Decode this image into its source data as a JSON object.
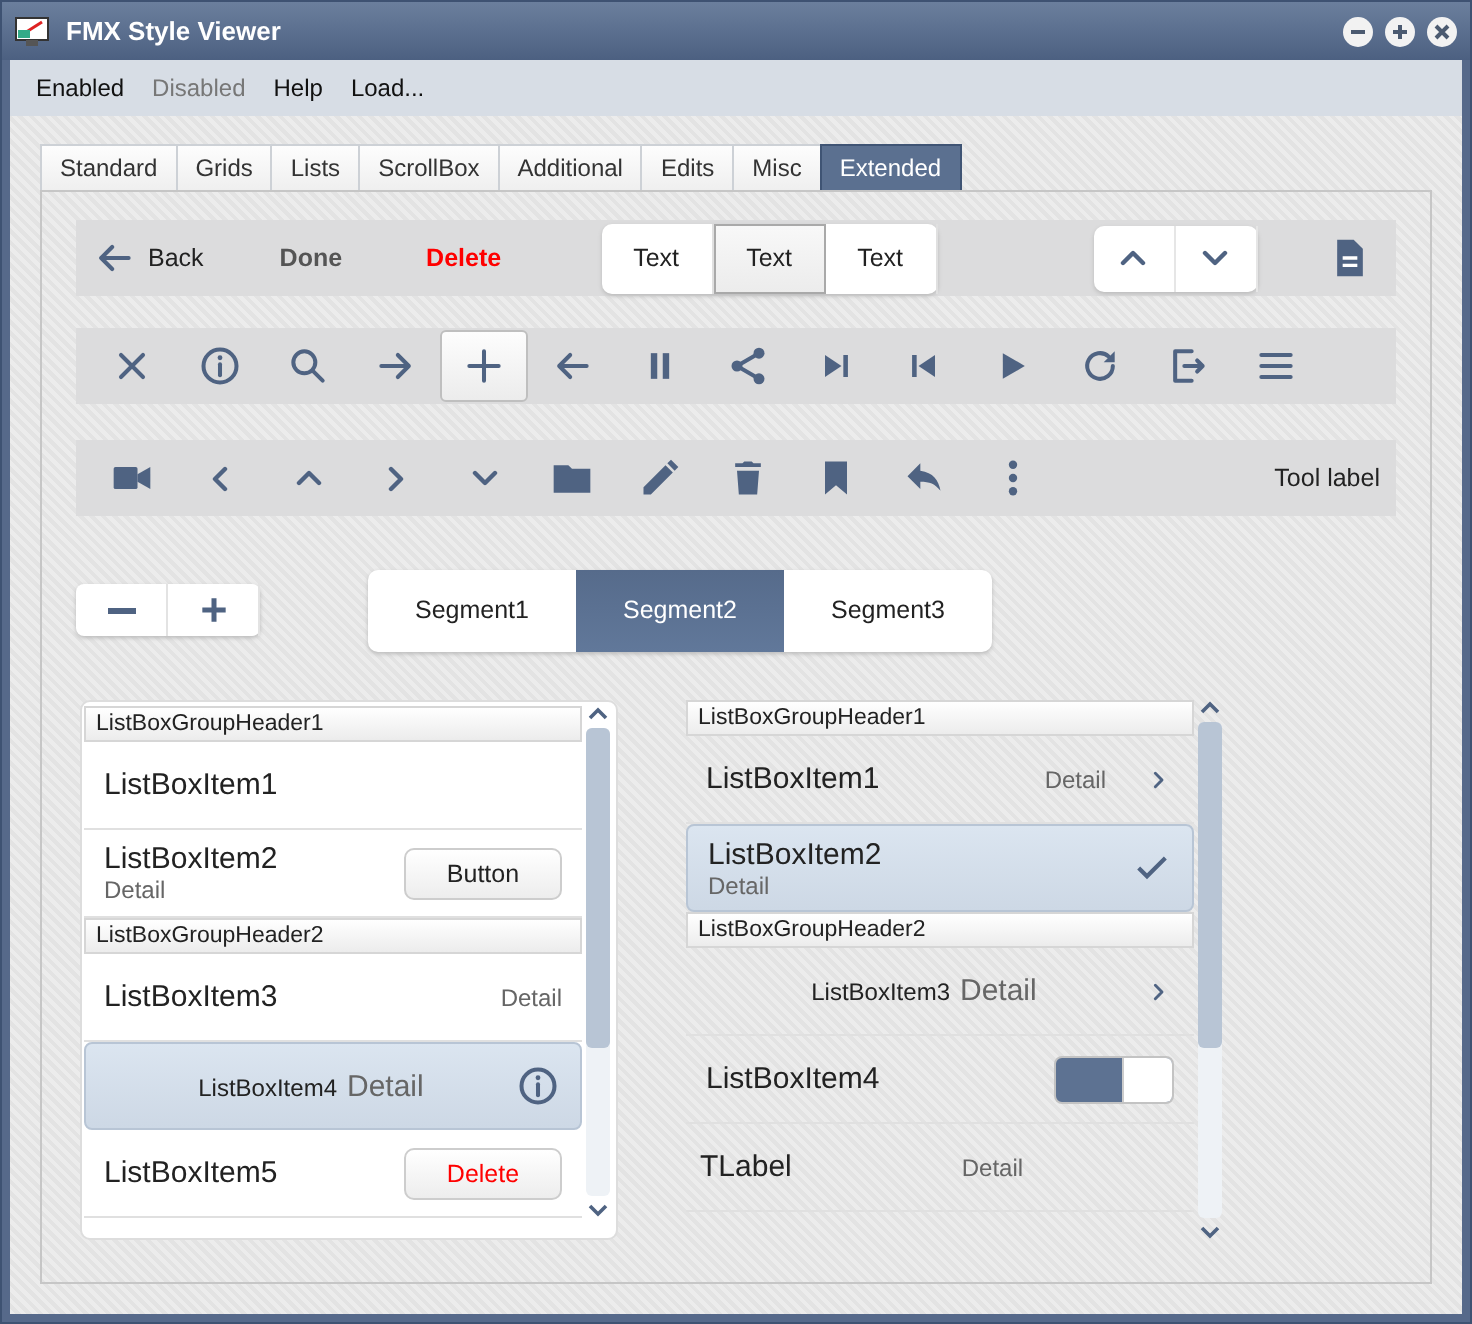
{
  "window": {
    "title": "FMX Style Viewer"
  },
  "menu": [
    {
      "label": "Enabled",
      "disabled": false
    },
    {
      "label": "Disabled",
      "disabled": true
    },
    {
      "label": "Help",
      "disabled": false
    },
    {
      "label": "Load...",
      "disabled": false
    }
  ],
  "tabs": [
    {
      "label": "Standard",
      "selected": false
    },
    {
      "label": "Grids",
      "selected": false
    },
    {
      "label": "Lists",
      "selected": false
    },
    {
      "label": "ScrollBox",
      "selected": false
    },
    {
      "label": "Additional",
      "selected": false
    },
    {
      "label": "Edits",
      "selected": false
    },
    {
      "label": "Misc",
      "selected": false
    },
    {
      "label": "Extended",
      "selected": true
    }
  ],
  "toolbar_1": {
    "buttons": [
      {
        "kind": "back",
        "label": "Back"
      },
      {
        "kind": "done",
        "label": "Done"
      },
      {
        "kind": "delete",
        "label": "Delete"
      }
    ],
    "segments": [
      {
        "label": "Text",
        "selected": false
      },
      {
        "label": "Text",
        "selected": true
      },
      {
        "label": "Text",
        "selected": false
      }
    ]
  },
  "toolbar_2": {
    "buttons": [
      {
        "pressed": false
      },
      {
        "pressed": false
      },
      {
        "pressed": false
      },
      {
        "pressed": false
      },
      {
        "pressed": true
      },
      {
        "pressed": false
      },
      {
        "pressed": false
      },
      {
        "pressed": false
      },
      {
        "pressed": false
      },
      {
        "pressed": false
      },
      {
        "pressed": false
      },
      {
        "pressed": false
      },
      {
        "pressed": false
      },
      {
        "pressed": false
      }
    ]
  },
  "toolbar_3": {
    "tool_label": "Tool label"
  },
  "segments": [
    {
      "label": "Segment1",
      "selected": false
    },
    {
      "label": "Segment2",
      "selected": true
    },
    {
      "label": "Segment3",
      "selected": false
    }
  ],
  "list_left": [
    {
      "kind": "header",
      "label": "ListBoxGroupHeader1"
    },
    {
      "kind": "plain",
      "label": "ListBoxItem1",
      "selected": false
    },
    {
      "kind": "subtitle_button",
      "label": "ListBoxItem2",
      "detail": "Detail",
      "button": "Button",
      "selected": false
    },
    {
      "kind": "header",
      "label": "ListBoxGroupHeader2"
    },
    {
      "kind": "right_detail",
      "label": "ListBoxItem3",
      "detail": "Detail",
      "selected": false
    },
    {
      "kind": "centered_info",
      "label": "ListBoxItem4",
      "detail": "Detail",
      "selected": true
    },
    {
      "kind": "delete_button",
      "label": "ListBoxItem5",
      "button": "Delete",
      "selected": false
    }
  ],
  "list_right": [
    {
      "kind": "header",
      "label": "ListBoxGroupHeader1"
    },
    {
      "kind": "right_detail_chevron",
      "label": "ListBoxItem1",
      "detail": "Detail",
      "selected": false
    },
    {
      "kind": "subtitle_check",
      "label": "ListBoxItem2",
      "detail": "Detail",
      "selected": true,
      "checked": true
    },
    {
      "kind": "header",
      "label": "ListBoxGroupHeader2"
    },
    {
      "kind": "centered_chevron",
      "label": "ListBoxItem3",
      "detail": "Detail",
      "selected": false
    },
    {
      "kind": "switch",
      "label": "ListBoxItem4",
      "on": true,
      "selected": false
    },
    {
      "kind": "label_detail",
      "label": "TLabel",
      "detail": "Detail",
      "selected": false
    }
  ]
}
